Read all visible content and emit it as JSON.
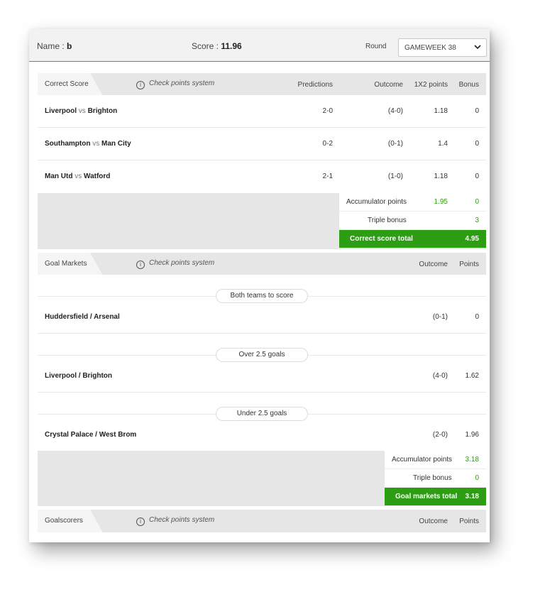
{
  "header": {
    "name_label": "Name :",
    "name_value": "b",
    "score_label": "Score :",
    "score_value": "11.96",
    "round_label": "Round",
    "round_selected": "GAMEWEEK 38"
  },
  "info_text": "Check points system",
  "correct_score": {
    "tab_label": "Correct Score",
    "columns": [
      "Predictions",
      "Outcome",
      "1X2 points",
      "Bonus"
    ],
    "rows": [
      {
        "home": "Liverpool",
        "vs": "vs",
        "away": "Brighton",
        "prediction": "2-0",
        "outcome": "(4-0)",
        "points": "1.18",
        "bonus": "0"
      },
      {
        "home": "Southampton",
        "vs": "vs",
        "away": "Man City",
        "prediction": "0-2",
        "outcome": "(0-1)",
        "points": "1.4",
        "bonus": "0"
      },
      {
        "home": "Man Utd",
        "vs": "vs",
        "away": "Watford",
        "prediction": "2-1",
        "outcome": "(1-0)",
        "points": "1.18",
        "bonus": "0"
      }
    ],
    "accumulator_label": "Accumulator points",
    "accumulator_points": "1.95",
    "accumulator_bonus": "0",
    "triple_label": "Triple bonus",
    "triple_value": "3",
    "total_label": "Correct score total",
    "total_value": "4.95"
  },
  "goal_markets": {
    "tab_label": "Goal Markets",
    "columns": [
      "Outcome",
      "Points"
    ],
    "groups": [
      {
        "market": "Both teams to score",
        "match": "Huddersfield / Arsenal",
        "outcome": "(0-1)",
        "points": "0"
      },
      {
        "market": "Over 2.5 goals",
        "match": "Liverpool / Brighton",
        "outcome": "(4-0)",
        "points": "1.62"
      },
      {
        "market": "Under 2.5 goals",
        "match": "Crystal Palace / West Brom",
        "outcome": "(2-0)",
        "points": "1.96"
      }
    ],
    "accumulator_label": "Accumulator points",
    "accumulator_value": "3.18",
    "triple_label": "Triple bonus",
    "triple_value": "0",
    "total_label": "Goal markets total",
    "total_value": "3.18"
  },
  "goalscorers": {
    "tab_label": "Goalscorers",
    "columns": [
      "Outcome",
      "Points"
    ]
  },
  "colors": {
    "accent_green": "#2d9e14",
    "positive_text": "#2f9e12"
  }
}
